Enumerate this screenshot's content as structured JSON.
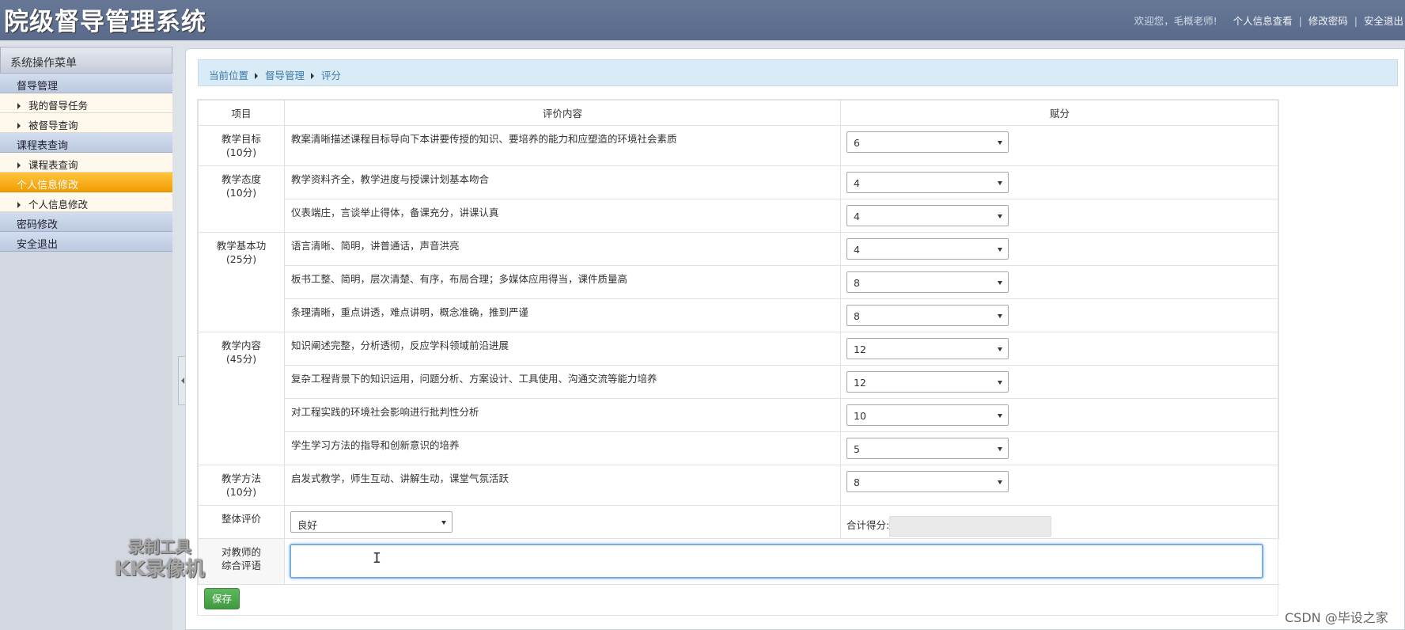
{
  "header": {
    "title": "院级督导管理系统",
    "welcome": "欢迎您，毛概老师!",
    "links": [
      "个人信息查看",
      "修改密码",
      "安全退出"
    ],
    "separator": "|"
  },
  "sidebar": {
    "menu_title": "系统操作菜单",
    "groups": [
      {
        "label": "督导管理",
        "active": false,
        "items": [
          "我的督导任务",
          "被督导查询"
        ]
      },
      {
        "label": "课程表查询",
        "active": false,
        "items": [
          "课程表查询"
        ]
      },
      {
        "label": "个人信息修改",
        "active": true,
        "items": [
          "个人信息修改"
        ]
      },
      {
        "label": "密码修改",
        "active": false,
        "items": []
      },
      {
        "label": "安全退出",
        "active": false,
        "items": []
      }
    ]
  },
  "breadcrumb": [
    "当前位置",
    "督导管理",
    "评分"
  ],
  "table": {
    "headers": [
      "项目",
      "评价内容",
      "赋分"
    ],
    "sections": [
      {
        "item": "教学目标",
        "points": "(10分)",
        "rows": [
          {
            "content": "教案清晰描述课程目标导向下本讲要传授的知识、要培养的能力和应塑造的环境社会素质",
            "score": "6"
          }
        ]
      },
      {
        "item": "教学态度",
        "points": "(10分)",
        "rows": [
          {
            "content": "教学资料齐全，教学进度与授课计划基本吻合",
            "score": "4"
          },
          {
            "content": "仪表端庄，言谈举止得体，备课充分，讲课认真",
            "score": "4"
          }
        ]
      },
      {
        "item": "教学基本功",
        "points": "(25分)",
        "rows": [
          {
            "content": "语言清晰、简明，讲普通话，声音洪亮",
            "score": "4"
          },
          {
            "content": "板书工整、简明，层次清楚、有序，布局合理；多媒体应用得当，课件质量高",
            "score": "8"
          },
          {
            "content": "条理清晰，重点讲透，难点讲明，概念准确，推到严谨",
            "score": "8"
          }
        ]
      },
      {
        "item": "教学内容",
        "points": "(45分)",
        "rows": [
          {
            "content": "知识阐述完整，分析透彻，反应学科领域前沿进展",
            "score": "12"
          },
          {
            "content": "复杂工程背景下的知识运用，问题分析、方案设计、工具使用、沟通交流等能力培养",
            "score": "12"
          },
          {
            "content": "对工程实践的环境社会影响进行批判性分析",
            "score": "10"
          },
          {
            "content": "学生学习方法的指导和创新意识的培养",
            "score": "5"
          }
        ]
      },
      {
        "item": "教学方法",
        "points": "(10分)",
        "rows": [
          {
            "content": "启发式教学，师生互动、讲解生动，课堂气氛活跃",
            "score": "8"
          }
        ]
      }
    ],
    "overall_label": "整体评价",
    "overall_value": "良好",
    "total_label": "合计得分:",
    "total_value": "",
    "comment_label_1": "对教师的",
    "comment_label_2": "综合评语",
    "comment_value": ""
  },
  "save_label": "保存",
  "watermark": {
    "line1": "录制工具",
    "line2": "KK录像机"
  },
  "csdn_watermark": "CSDN @毕设之家"
}
